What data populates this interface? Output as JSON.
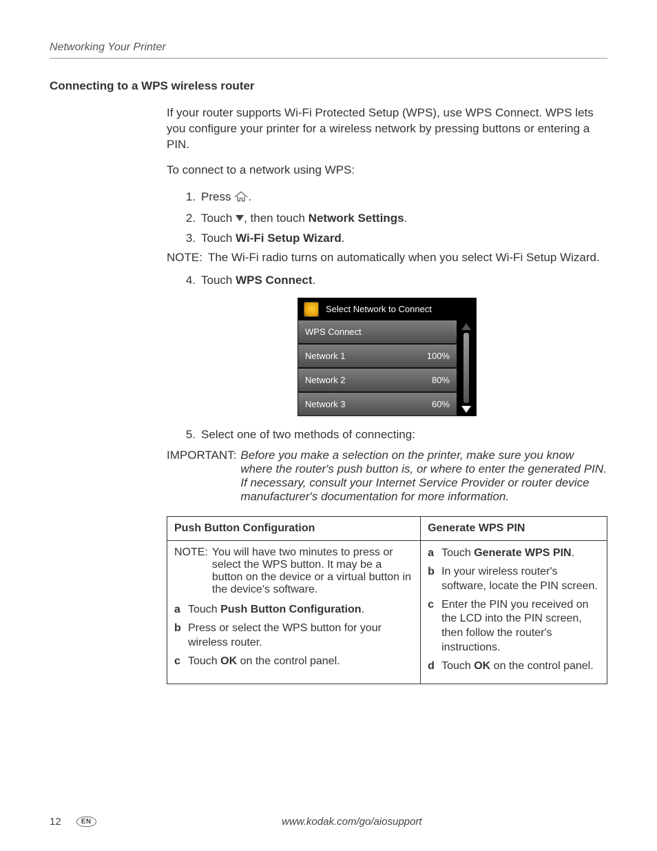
{
  "running_head": "Networking Your Printer",
  "section_title": "Connecting to a WPS wireless router",
  "intro_para": "If your router supports Wi-Fi Protected Setup (WPS), use WPS Connect. WPS lets you configure your printer for a wireless network by pressing buttons or entering a PIN.",
  "connect_intro": "To connect to a network using WPS:",
  "steps": {
    "s1_a": "Press ",
    "s1_b": ".",
    "s2_a": "Touch ",
    "s2_b": ", then touch ",
    "s2_bold": "Network Settings",
    "s2_c": ".",
    "s3_a": "Touch ",
    "s3_bold": "Wi-Fi Setup Wizard",
    "s3_b": ".",
    "s4_a": "Touch ",
    "s4_bold": "WPS Connect",
    "s4_b": ".",
    "s5": "Select one of two methods of connecting:"
  },
  "note_label": "NOTE:",
  "note_text": "The Wi-Fi radio turns on automatically when you select Wi-Fi Setup Wizard.",
  "lcd": {
    "title": "Select Network to Connect",
    "rows": [
      {
        "name": "WPS Connect",
        "signal": ""
      },
      {
        "name": "Network 1",
        "signal": "100%"
      },
      {
        "name": "Network 2",
        "signal": "80%"
      },
      {
        "name": "Network 3",
        "signal": "60%"
      }
    ]
  },
  "important_label": "IMPORTANT:",
  "important_text": "Before you make a selection on the printer, make sure you know where the router's push button is, or where to enter the generated PIN. If necessary, consult your Internet Service Provider or router device manufacturer's documentation for more information.",
  "table": {
    "col1_header": "Push Button Configuration",
    "col2_header": "Generate WPS PIN",
    "col1_note_label": "NOTE:",
    "col1_note": "You will have two minutes to press or select the WPS button. It may be a button on the device or a virtual button in the device's software.",
    "col1_a_pre": "Touch ",
    "col1_a_bold": "Push Button Configuration",
    "col1_a_post": ".",
    "col1_b": "Press or select the WPS button for your wireless router.",
    "col1_c_pre": "Touch ",
    "col1_c_bold": "OK",
    "col1_c_post": " on the control panel.",
    "col2_a_pre": "Touch ",
    "col2_a_bold": "Generate WPS PIN",
    "col2_a_post": ".",
    "col2_b": "In your wireless router's software, locate the PIN screen.",
    "col2_c": "Enter the PIN you received on the LCD into the PIN screen, then follow the router's instructions.",
    "col2_d_pre": "Touch ",
    "col2_d_bold": "OK",
    "col2_d_post": " on the control panel."
  },
  "footer": {
    "page": "12",
    "lang": "EN",
    "url": "www.kodak.com/go/aiosupport"
  }
}
